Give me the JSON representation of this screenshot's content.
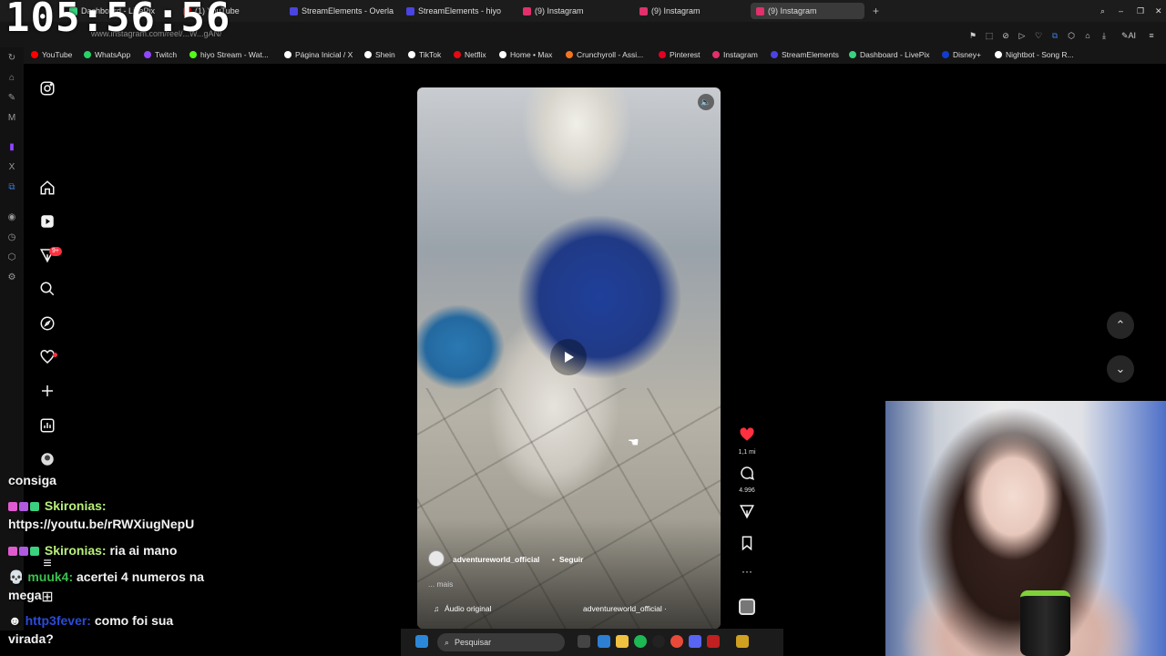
{
  "stream_overlay": {
    "clock": "105:56:56"
  },
  "browser": {
    "tabs": [
      {
        "label": "Dashboard - LivePix",
        "color": "#3ad17f"
      },
      {
        "label": "(1) YouTube",
        "color": "#ff0000"
      },
      {
        "label": "StreamElements - Overla",
        "color": "#4a44e0"
      },
      {
        "label": "StreamElements - hiyo",
        "color": "#4a44e0"
      },
      {
        "label": "(9) Instagram",
        "color": "#e1306c"
      },
      {
        "label": "(9) Instagram",
        "color": "#e1306c"
      },
      {
        "label": "(9) Instagram",
        "color": "#e1306c",
        "active": true
      }
    ],
    "address": "www.instagram.com/reel/...W...gAN/",
    "bookmarks": [
      {
        "label": "YouTube",
        "color": "#ff0000"
      },
      {
        "label": "WhatsApp",
        "color": "#25d366"
      },
      {
        "label": "Twitch",
        "color": "#9146ff"
      },
      {
        "label": "hiyo Stream - Wat...",
        "color": "#53fc18"
      },
      {
        "label": "Página Inicial / X",
        "color": "#ffffff"
      },
      {
        "label": "Shein",
        "color": "#ffffff"
      },
      {
        "label": "TikTok",
        "color": "#ffffff"
      },
      {
        "label": "Netflix",
        "color": "#e50914"
      },
      {
        "label": "Home • Max",
        "color": "#ffffff"
      },
      {
        "label": "Crunchyroll - Assi...",
        "color": "#f47521"
      },
      {
        "label": "Pinterest",
        "color": "#e60023"
      },
      {
        "label": "Instagram",
        "color": "#e1306c"
      },
      {
        "label": "StreamElements",
        "color": "#4a44e0"
      },
      {
        "label": "Dashboard - LivePix",
        "color": "#3ad17f"
      },
      {
        "label": "Disney+",
        "color": "#113ccf"
      },
      {
        "label": "Nightbot - Song R...",
        "color": "#ffffff"
      }
    ]
  },
  "reel": {
    "author": "adventureworld_official",
    "follow": "Seguir",
    "caption_more": "... mais",
    "audio": "Áudio original",
    "audio_author": "adventureworld_official ·",
    "likes": "1,1 mi",
    "comments": "4.996"
  },
  "nav": {
    "notifications_badge": "9+"
  },
  "chat": [
    {
      "user": "",
      "text": "consiga"
    },
    {
      "user": "Skironias:",
      "text": ""
    },
    {
      "user": "",
      "text": "https://youtu.be/rRWXiugNepU"
    },
    {
      "user": "Skironias:",
      "text": "ria ai mano"
    },
    {
      "user": "muuk4:",
      "text": "acertei 4 numeros na"
    },
    {
      "user": "",
      "text": "mega"
    },
    {
      "user": "http3fever:",
      "text": "como foi sua"
    },
    {
      "user": "",
      "text": "virada?"
    }
  ],
  "taskbar": {
    "search_placeholder": "Pesquisar"
  },
  "colors": {
    "accent": "#ff3040",
    "chat_user": "#b8f07a"
  }
}
